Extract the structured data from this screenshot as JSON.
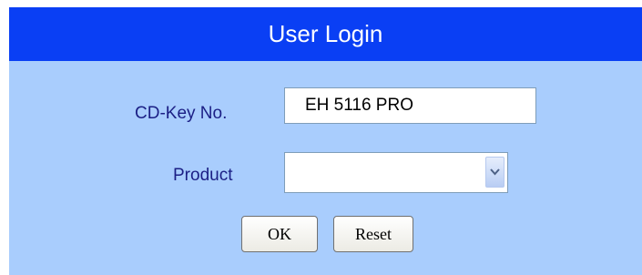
{
  "dialog": {
    "title": "User Login",
    "cdkey": {
      "label": "CD-Key No.",
      "value": "EH 5116 PRO"
    },
    "product": {
      "label": "Product",
      "selected": ""
    },
    "buttons": {
      "ok": "OK",
      "reset": "Reset"
    }
  },
  "colors": {
    "titlebar": "#0a3ff4",
    "panel": "#a9cdfd",
    "label": "#1b1f85"
  },
  "icons": {
    "select_arrow": "chevron-down-icon"
  }
}
